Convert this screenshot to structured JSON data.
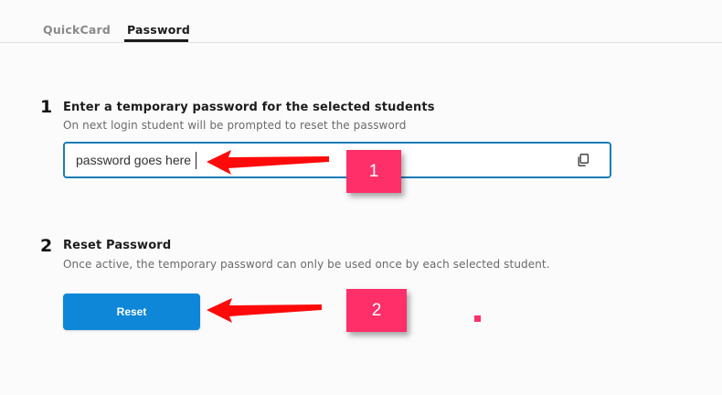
{
  "tabs": [
    {
      "label": "QuickCard",
      "active": false
    },
    {
      "label": "Password",
      "active": true
    }
  ],
  "step1": {
    "number": "1",
    "title": "Enter a temporary password for the selected students",
    "description": "On next login student will be prompted to reset the password",
    "password_value": "password goes here",
    "copy_icon": "copy-icon"
  },
  "step2": {
    "number": "2",
    "title": "Reset Password",
    "description": "Once active, the temporary password can only be used once by each selected student.",
    "button_label": "Reset"
  },
  "annotations": {
    "badge_1": "1",
    "badge_2": "2",
    "color": "#ff2f6a",
    "arrow_color": "#ff0000"
  },
  "colors": {
    "button_bg": "#0e87d8",
    "input_border": "#1d7cb4"
  }
}
